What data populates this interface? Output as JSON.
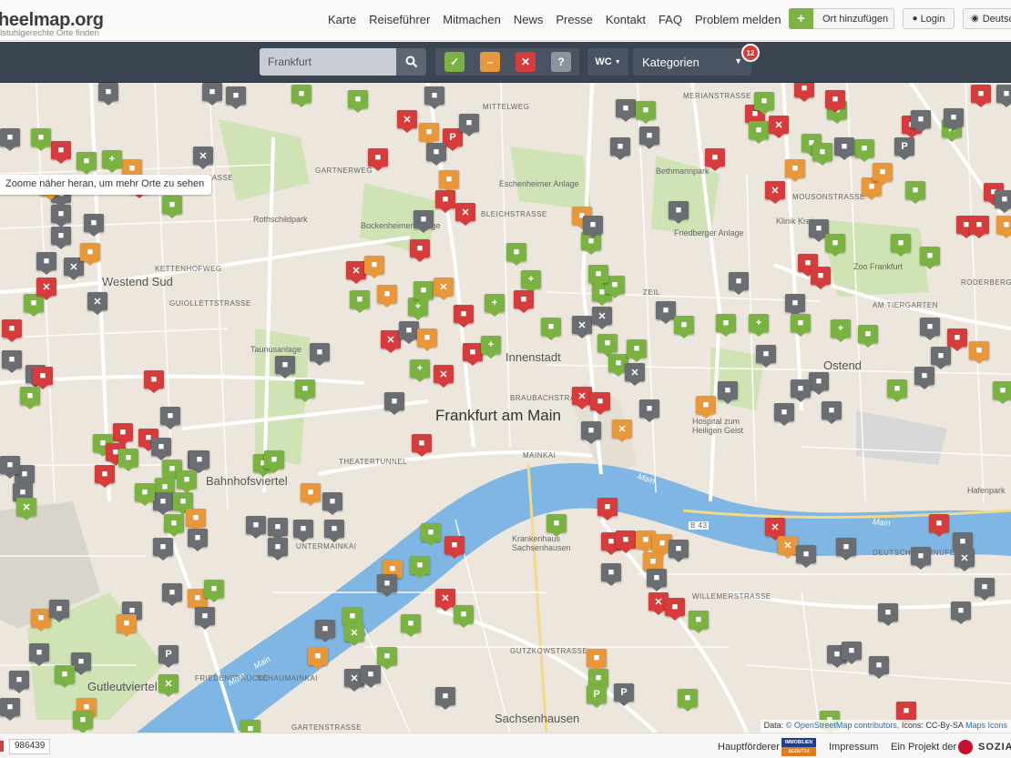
{
  "header": {
    "logo": "heelmap.org",
    "tagline": "ilstuhlgerechte Orte finden",
    "nav": [
      "Karte",
      "Reiseführer",
      "Mitmachen",
      "News",
      "Presse",
      "Kontakt",
      "FAQ",
      "Problem melden"
    ],
    "add_place": "Ort hinzufügen",
    "login": "Login",
    "language": "Deutsc"
  },
  "filterbar": {
    "search_value": "Frankfurt",
    "wc_label": "WC",
    "categories_label": "Kategorien",
    "categories_count": "12",
    "colors": {
      "yes": "#7ab342",
      "limited": "#e8973a",
      "no": "#d63c3c",
      "unknown": "#8e949b"
    }
  },
  "map": {
    "zoom_hint": "Zoome näher heran, um mehr Orte zu sehen",
    "city": "Frankfurt am Main",
    "districts": {
      "westend": "Westend Sud",
      "innenstadt": "Innenstadt",
      "ostend": "Ostend",
      "bahnhof": "Bahnhofsviertel",
      "gutleut": "Gutleutviertel",
      "sachsenhausen": "Sachsenhausen"
    },
    "streets": {
      "s1": "KETTENHOFWEG",
      "s2": "GUIOLLETTSTRASSE",
      "s3": "STAUFENSTRASSE",
      "s4": "GARTNERWEG",
      "s5": "BLEICHSTRASSE",
      "s6": "THEATERTUNNEL",
      "s7": "BRAUBACHSTRASSE",
      "s8": "MAINKAI",
      "s9": "UNTERMAINKAI",
      "s10": "SCHAUMAINKAI",
      "s11": "GUTZKOWSTRASSE",
      "s12": "WILLEMERSTRASSE",
      "s13": "MOUSONSTRASSE",
      "s14": "ZEIL",
      "s15": "MITTELWEG",
      "s16": "MERIANSTRASSE",
      "s17": "GARTENSTRASSE",
      "s18": "AM TIERGARTEN",
      "s19": "RODERBERGWEG",
      "s20": "DEUTSCHHERRNUFER",
      "s21": "B 43",
      "s22": "FRIEDENSBRÜCKE"
    },
    "pois": {
      "p1": "Rothschildpark",
      "p2": "Bockenheimer Anlage",
      "p3": "Eschenheimer Anlage",
      "p4": "Bethmannpark",
      "p5": "Friedberger Anlage",
      "p6": "Zoo Frankfurt",
      "p7": "Taunusanlage",
      "p8": "Hospital zum Heiligen Geist",
      "p9": "Krankenhaus Sachsenhausen",
      "p10": "Hafenpark",
      "p11": "Klinik Krei"
    },
    "river_labels": [
      "Main",
      "Main",
      "Main",
      "Main"
    ]
  },
  "attribution": {
    "prefix": "Data:",
    "osm": "© OpenStreetMap contributors,",
    "icons": "Icons: CC-By-SA",
    "maps": "Maps Icons"
  },
  "footer": {
    "count": "986439",
    "sponsor_label": "Hauptförderer",
    "sponsor_logo_top": "IMMOBILIEN",
    "sponsor_logo_bottom": "SCOUT24",
    "impressum": "Impressum",
    "project_label": "Ein Projekt der",
    "sozial": "SOZIAL"
  }
}
